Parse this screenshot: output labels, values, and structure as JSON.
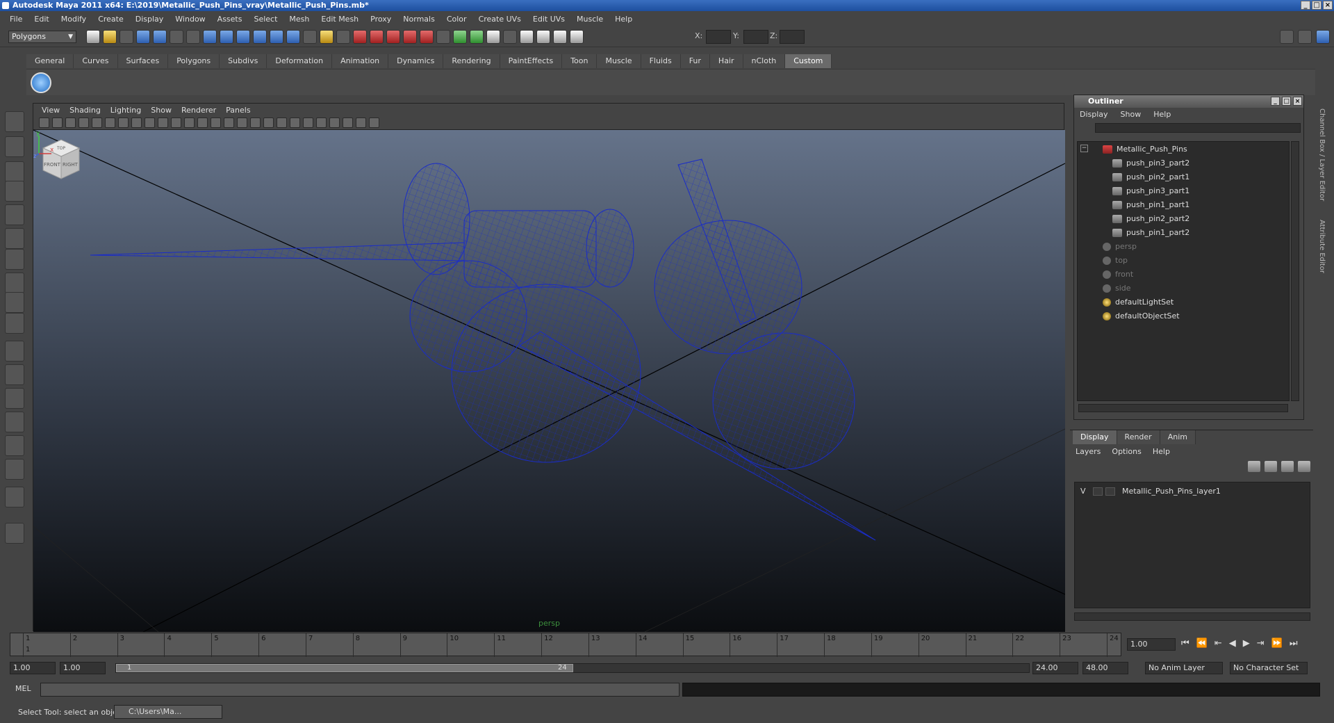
{
  "window": {
    "title": "Autodesk Maya 2011 x64: E:\\2019\\Metallic_Push_Pins_vray\\Metallic_Push_Pins.mb*"
  },
  "menubar": [
    "File",
    "Edit",
    "Modify",
    "Create",
    "Display",
    "Window",
    "Assets",
    "Select",
    "Mesh",
    "Edit Mesh",
    "Proxy",
    "Normals",
    "Color",
    "Create UVs",
    "Edit UVs",
    "Muscle",
    "Help"
  ],
  "status_line": {
    "mode": "Polygons",
    "x_label": "X:",
    "y_label": "Y:",
    "z_label": "Z:"
  },
  "shelf_tabs": [
    "General",
    "Curves",
    "Surfaces",
    "Polygons",
    "Subdivs",
    "Deformation",
    "Animation",
    "Dynamics",
    "Rendering",
    "PaintEffects",
    "Toon",
    "Muscle",
    "Fluids",
    "Fur",
    "Hair",
    "nCloth",
    "Custom"
  ],
  "shelf_active": "Custom",
  "panel": {
    "menu": [
      "View",
      "Shading",
      "Lighting",
      "Show",
      "Renderer",
      "Panels"
    ],
    "camera_label": "persp",
    "viewcube": {
      "front": "FRONT",
      "right": "RIGHT",
      "top": "TOP"
    },
    "axis": {
      "x": "x",
      "y": "y",
      "z": "z"
    }
  },
  "outliner": {
    "title": "Outliner",
    "menu": [
      "Display",
      "Show",
      "Help"
    ],
    "items": [
      {
        "label": "Metallic_Push_Pins",
        "type": "group",
        "dim": false
      },
      {
        "label": "push_pin3_part2",
        "type": "mesh",
        "dim": false
      },
      {
        "label": "push_pin2_part1",
        "type": "mesh",
        "dim": false
      },
      {
        "label": "push_pin3_part1",
        "type": "mesh",
        "dim": false
      },
      {
        "label": "push_pin1_part1",
        "type": "mesh",
        "dim": false
      },
      {
        "label": "push_pin2_part2",
        "type": "mesh",
        "dim": false
      },
      {
        "label": "push_pin1_part2",
        "type": "mesh",
        "dim": false
      },
      {
        "label": "persp",
        "type": "camera",
        "dim": true
      },
      {
        "label": "top",
        "type": "camera",
        "dim": true
      },
      {
        "label": "front",
        "type": "camera",
        "dim": true
      },
      {
        "label": "side",
        "type": "camera",
        "dim": true
      },
      {
        "label": "defaultLightSet",
        "type": "set",
        "dim": false
      },
      {
        "label": "defaultObjectSet",
        "type": "set",
        "dim": false
      }
    ]
  },
  "layer_editor": {
    "tabs": [
      "Display",
      "Render",
      "Anim"
    ],
    "active_tab": "Display",
    "menu": [
      "Layers",
      "Options",
      "Help"
    ],
    "layers": [
      {
        "visible": "V",
        "name": "Metallic_Push_Pins_layer1"
      }
    ]
  },
  "right_strip": {
    "channel_box": "Channel Box / Layer Editor",
    "attribute_editor": "Attribute Editor"
  },
  "time_slider": {
    "ticks": [
      "1",
      "2",
      "3",
      "4",
      "5",
      "6",
      "7",
      "8",
      "9",
      "10",
      "11",
      "12",
      "13",
      "14",
      "15",
      "16",
      "17",
      "18",
      "19",
      "20",
      "21",
      "22",
      "23",
      "24"
    ],
    "current_frame_marker": "1",
    "current_time": "1.00"
  },
  "playback": [
    "⏮",
    "⏪",
    "⇤",
    "◀",
    "▶",
    "⇥",
    "⏩",
    "⏭"
  ],
  "range": {
    "start": "1.00",
    "playback_start": "1.00",
    "slider_left": "1",
    "slider_right": "24",
    "playback_end": "24.00",
    "end": "48.00",
    "anim_layer": "No Anim Layer",
    "character_set": "No Character Set"
  },
  "command_line": {
    "label": "MEL"
  },
  "help_line": {
    "text": "Select Tool: select an object",
    "task": "C:\\Users\\Ma..."
  },
  "colors": {
    "wire": "#1a2cc8",
    "titlebar": "#1d4f9f",
    "viewport_top": "#65738a",
    "viewport_bottom": "#0b0d10"
  }
}
